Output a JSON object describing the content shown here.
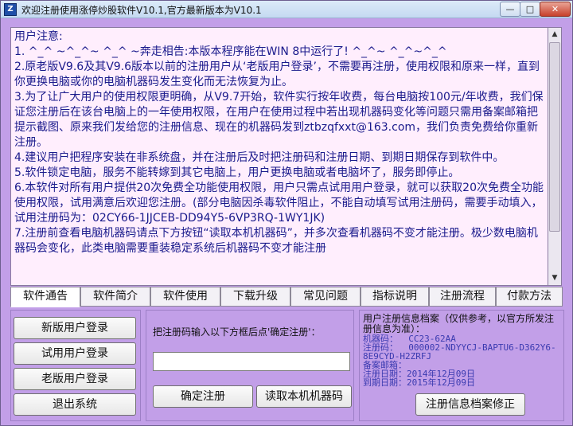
{
  "window": {
    "title": "欢迎注册使用涨停炒股软件V10.1,官方最新版本为V10.1",
    "min_label": "—",
    "max_label": "□",
    "close_label": "✕"
  },
  "notice": {
    "text": "用户注意:\n1. ^_^ ~^_^~ ^_^ ~奔走相告:本版本程序能在WIN 8中运行了! ^_^~ ^_^~^_^\n2.原老版V9.6及其V9.6版本以前的注册用户从‘老版用户登录’，不需要再注册，使用权限和原来一样，直到你更换电脑或你的电脑机器码发生变化而无法恢复为止。\n3.为了让广大用户的使用权限更明确，从V9.7开始，软件实行按年收费，每台电脑按100元/年收费，我们保证您注册后在该台电脑上的一年使用权限，在用户在使用过程中若出现机器码变化等问题只需用备案邮箱把提示截图、原来我们发给您的注册信息、现在的机器码发到ztbzqfxxt@163.com，我们负责免费给你重新注册。\n4.建议用户把程序安装在非系统盘，并在注册后及时把注册码和注册日期、到期日期保存到软件中。\n5.软件锁定电脑，服务不能转嫁到其它电脑上，用户更换电脑或者电脑坏了，服务即停止。\n6.本软件对所有用户提供20次免费全功能使用权限，用户只需点试用用户登录，就可以获取20次免费全功能使用权限，试用满意后欢迎您注册。(部分电脑因杀毒软件阻止，不能自动填写试用注册码，需要手动填入，试用注册码为：02CY66-1JJCEB-DD94Y5-6VP3RQ-1WY1JK)\n7.注册前查看电脑机器码请点下方按钮“读取本机机器码”，并多次查看机器码不变才能注册。极少数电脑机器码会变化，此类电脑需要重装稳定系统后机器码不变才能注册"
  },
  "tabs": [
    "软件通告",
    "软件简介",
    "软件使用",
    "下载升级",
    "常见问题",
    "指标说明",
    "注册流程",
    "付款方法"
  ],
  "buttons": {
    "new_user": "新版用户登录",
    "trial_user": "试用用户登录",
    "old_user": "老版用户登录",
    "exit": "退出系统",
    "confirm": "确定注册",
    "read_code": "读取本机机器码",
    "fix_archive": "注册信息档案修正"
  },
  "registration": {
    "label": "把注册码输入以下方框后点'确定注册'：",
    "value": ""
  },
  "archive": {
    "title": "用户注册信息档案（仅供参考，以官方所发注册信息为准）：",
    "lines": "机器码：  CC23-62AA\n注册码：  000002-NDYYCJ-BAPTU6-D362Y6-\n8E9CYD-H2ZRFJ\n备案邮箱：\n注册日期：2014年12月09日\n到期日期：2015年12月09日"
  },
  "icons": {
    "app": "app-logo-icon"
  }
}
